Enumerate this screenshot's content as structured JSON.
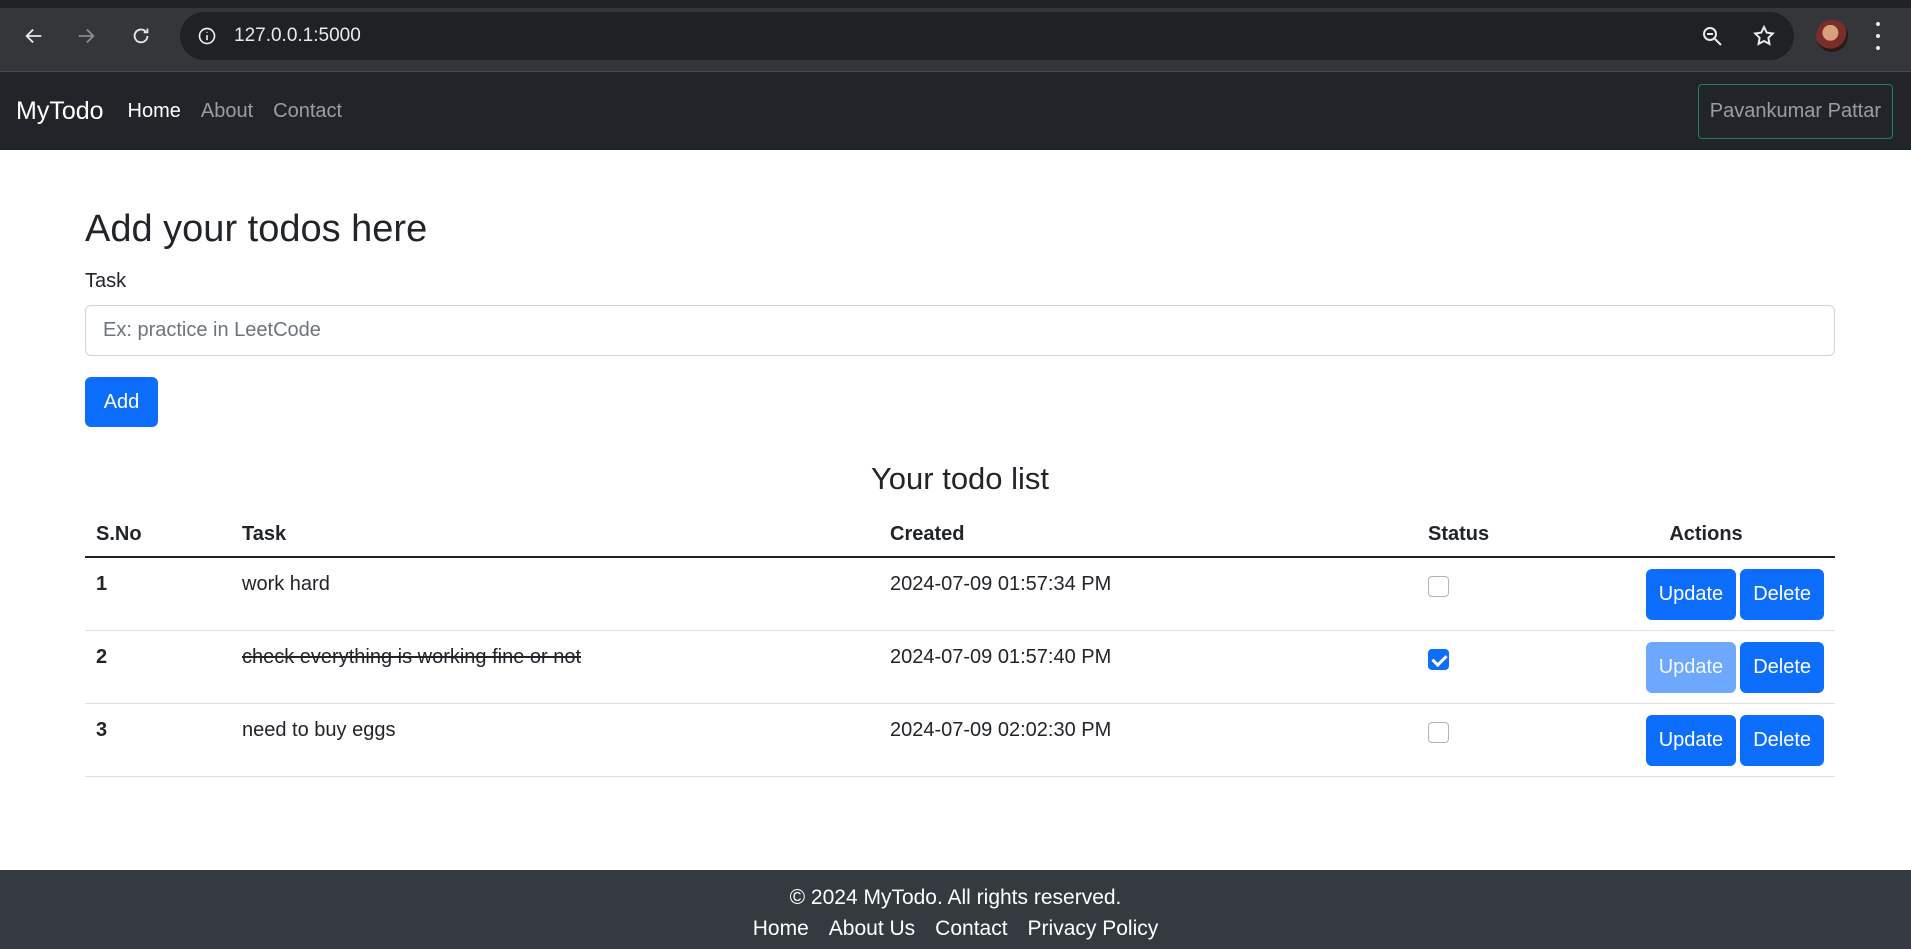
{
  "browser": {
    "url": "127.0.0.1:5000",
    "icons": [
      "back-icon",
      "forward-icon",
      "reload-icon",
      "info-icon",
      "zoom-icon",
      "star-icon",
      "profile-avatar",
      "menu-icon"
    ]
  },
  "navbar": {
    "brand": "MyTodo",
    "links": [
      {
        "label": "Home",
        "active": true
      },
      {
        "label": "About",
        "active": false
      },
      {
        "label": "Contact",
        "active": false
      }
    ],
    "user": "Pavankumar Pattar"
  },
  "form": {
    "title": "Add your todos here",
    "task_label": "Task",
    "task_placeholder": "Ex: practice in LeetCode",
    "task_value": "",
    "add_label": "Add"
  },
  "list": {
    "title": "Your todo list",
    "headers": [
      "S.No",
      "Task",
      "Created",
      "Status",
      "Actions"
    ],
    "rows": [
      {
        "sno": "1",
        "task": "work hard",
        "created": "2024-07-09 01:57:34 PM",
        "done": false,
        "update": "Update",
        "delete": "Delete"
      },
      {
        "sno": "2",
        "task": "check everything is working fine or not",
        "created": "2024-07-09 01:57:40 PM",
        "done": true,
        "update": "Update",
        "delete": "Delete"
      },
      {
        "sno": "3",
        "task": "need to buy eggs",
        "created": "2024-07-09 02:02:30 PM",
        "done": false,
        "update": "Update",
        "delete": "Delete"
      }
    ]
  },
  "footer": {
    "copyright": "© 2024 MyTodo. All rights reserved.",
    "links": [
      "Home",
      "About Us",
      "Contact",
      "Privacy Policy"
    ]
  },
  "colors": {
    "primary": "#0d6efd",
    "navbar": "#212529",
    "footer": "#343a40",
    "user_border": "#198754"
  }
}
